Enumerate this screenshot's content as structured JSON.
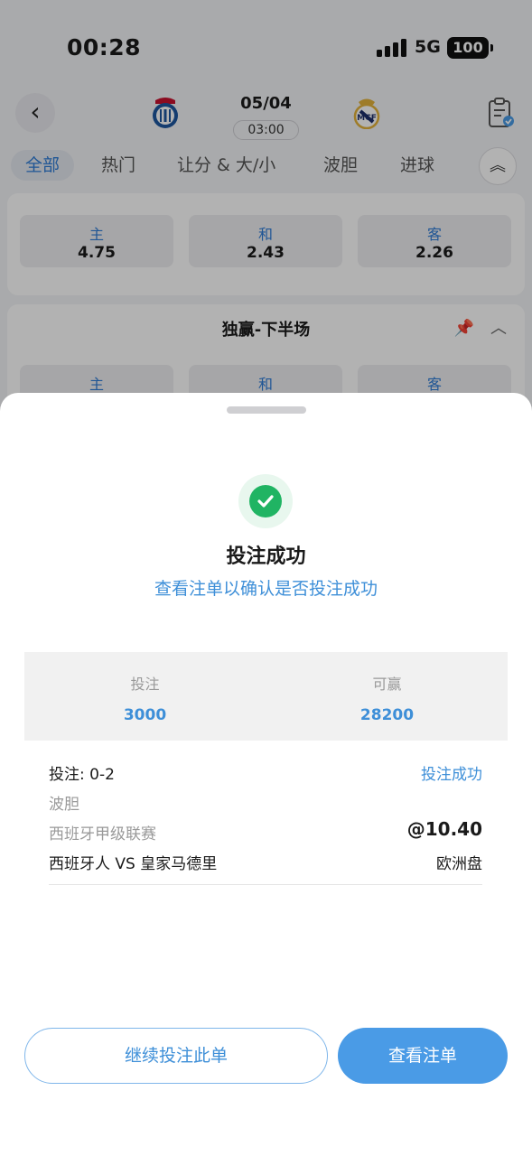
{
  "status_bar": {
    "time": "00:28",
    "network": "5G",
    "battery": "100"
  },
  "match": {
    "date": "05/04",
    "kickoff": "03:00",
    "home_logo": "espanyol-crest-icon",
    "away_logo": "real-madrid-crest-icon"
  },
  "tabs": [
    "全部",
    "热门",
    "让分 & 大/小",
    "波胆",
    "进球"
  ],
  "market_top": {
    "options": [
      {
        "label": "主",
        "odds": "4.75"
      },
      {
        "label": "和",
        "odds": "2.43"
      },
      {
        "label": "客",
        "odds": "2.26"
      }
    ]
  },
  "market_second": {
    "title": "独赢-下半场",
    "options": [
      {
        "label": "主"
      },
      {
        "label": "和"
      },
      {
        "label": "客"
      }
    ]
  },
  "sheet": {
    "title": "投注成功",
    "subtitle": "查看注单以确认是否投注成功",
    "summary": {
      "stake_label": "投注",
      "stake_value": "3000",
      "win_label": "可赢",
      "win_value": "28200"
    },
    "bet": {
      "selection": "投注: 0-2",
      "status": "投注成功",
      "market": "波胆",
      "league": "西班牙甲级联赛",
      "odds": "@10.40",
      "teams": "西班牙人 VS 皇家马德里",
      "odds_type": "欧洲盘"
    },
    "continue_label": "继续投注此单",
    "view_label": "查看注单"
  },
  "colors": {
    "accent": "#4a9be6",
    "success": "#20b463",
    "link": "#3e8fd8"
  }
}
